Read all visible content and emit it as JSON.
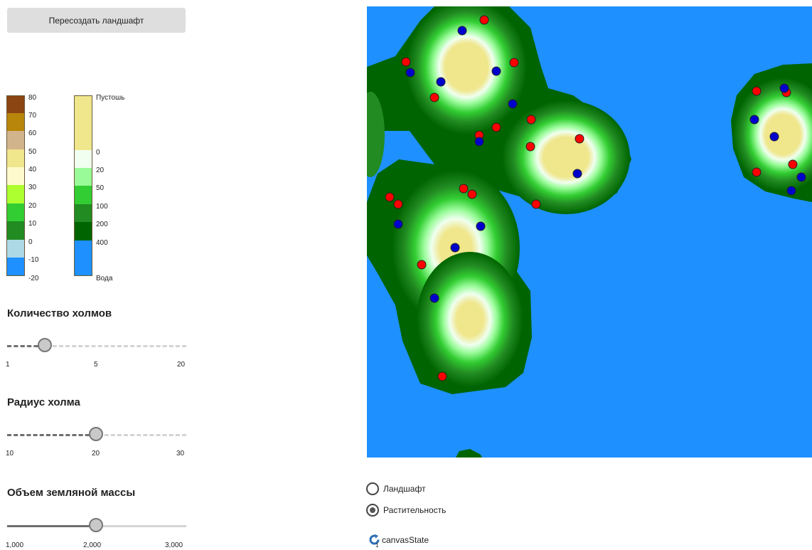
{
  "regenerate_button": "Пересоздать ландшафт",
  "elevation_legend": {
    "colors": [
      "#8b4513",
      "#b8860b",
      "#d2b48c",
      "#f0e68c",
      "#fffacd",
      "#adff2f",
      "#32cd32",
      "#228b22",
      "#add8e6",
      "#1e90ff"
    ],
    "labels": [
      "80",
      "70",
      "60",
      "50",
      "40",
      "30",
      "20",
      "10",
      "0",
      "-10",
      "-20"
    ]
  },
  "vegetation_legend": {
    "top_label": "Пустошь",
    "bottom_label": "Вода",
    "colors": [
      "#f0e68c",
      "#f0fff0",
      "#98fb98",
      "#32cd32",
      "#228b22",
      "#006400",
      "#1e90ff"
    ],
    "labels": [
      "0",
      "20",
      "50",
      "100",
      "200",
      "400"
    ]
  },
  "hills_count": {
    "title": "Количество холмов",
    "min_label": "1",
    "mid_label": "5",
    "max_label": "20",
    "value": 3,
    "min": 1,
    "max": 20
  },
  "hill_radius": {
    "title": "Радиус холма",
    "min_label": "10",
    "mid_label": "20",
    "max_label": "30",
    "value": 21,
    "min": 10,
    "max": 30
  },
  "earth_mass": {
    "title": "Объем земляной массы",
    "min_label": "1,000",
    "mid_label": "2,000",
    "max_label": "3,000",
    "value": 2000,
    "min": 1000,
    "max": 3000
  },
  "map": {
    "water_color": "#1e90ff",
    "marker_colors": {
      "red": "#ff0000",
      "blue": "#0000cd"
    }
  },
  "display_mode": {
    "options": [
      {
        "label": "Ландшафт",
        "selected": false
      },
      {
        "label": "Растительность",
        "selected": true
      }
    ]
  },
  "canvas_state": {
    "label": "canvasState",
    "sub": "1",
    "icon": "refresh-icon"
  }
}
